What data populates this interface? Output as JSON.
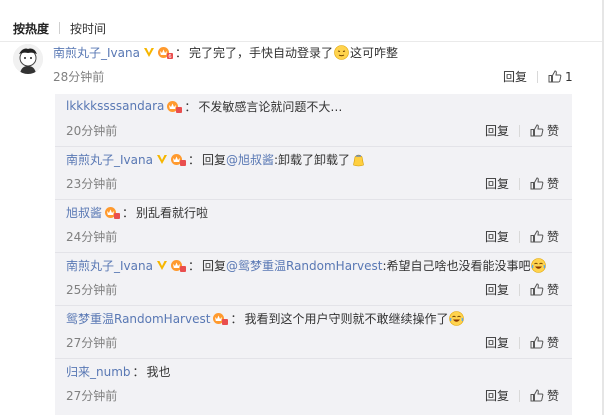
{
  "sort": {
    "hot_label": "按热度",
    "time_label": "按时间"
  },
  "main": {
    "username": "南煎丸子_Ivana",
    "separator": "：",
    "text": "完了完了，手快自动登录了",
    "text_after": "这可咋整",
    "time": "28分钟前",
    "reply_label": "回复",
    "like_count": "1"
  },
  "replies": [
    {
      "username": "lkkkkssssandara",
      "separator": "：",
      "text": "不发敏感言论就问题不大…",
      "time": "20分钟前",
      "reply_label": "回复",
      "like_label": "赞"
    },
    {
      "username": "南煎丸子_Ivana",
      "separator": "：",
      "reply_prefix": "回复",
      "mention": "@旭叔酱",
      "text": ":卸载了卸载了",
      "time": "23分钟前",
      "reply_label": "回复",
      "like_label": "赞"
    },
    {
      "username": "旭叔酱",
      "separator": "：",
      "text": "别乱看就行啦",
      "time": "24分钟前",
      "reply_label": "回复",
      "like_label": "赞"
    },
    {
      "username": "南煎丸子_Ivana",
      "separator": "：",
      "reply_prefix": "回复",
      "mention": "@鸳梦重温RandomHarvest",
      "text": ":希望自己啥也没看能没事吧",
      "time": "25分钟前",
      "reply_label": "回复",
      "like_label": "赞"
    },
    {
      "username": "鸳梦重温RandomHarvest",
      "separator": "：",
      "text": "我看到这个用户守则就不敢继续操作了",
      "time": "27分钟前",
      "reply_label": "回复",
      "like_label": "赞"
    },
    {
      "username": "归来_numb",
      "separator": "：",
      "text": "我也",
      "time": "27分钟前",
      "reply_label": "回复",
      "like_label": "赞"
    }
  ],
  "colors": {
    "username": "#eb7350",
    "username_blue": "#5978b4",
    "verified": "#f6b600",
    "vip": "#ff7f00",
    "reply_bg": "#f2f2f5"
  },
  "icons": {
    "verified": "verified-v-icon",
    "vip": "vip-crown-icon",
    "like": "thumbs-up-icon"
  }
}
